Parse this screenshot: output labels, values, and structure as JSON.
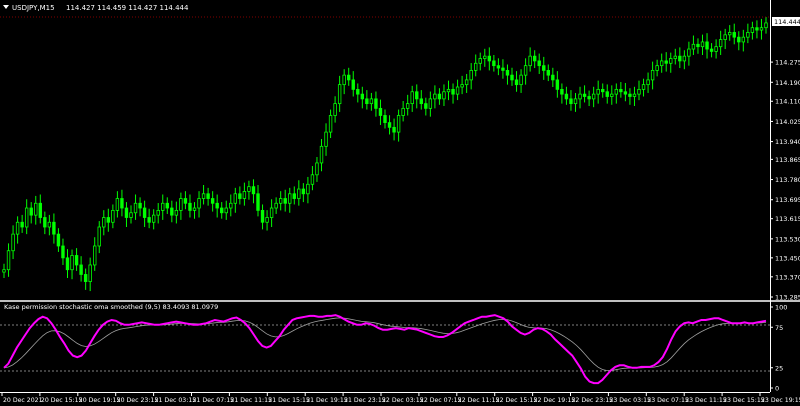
{
  "window": {
    "symbol_label": "USDJPY,M15",
    "ohlc_label": "114.427 114.459 114.427 114.444"
  },
  "main_chart": {
    "current_price_label": "114.444",
    "price_ticks": [
      "114.444",
      "114.275",
      "114.190",
      "114.110",
      "114.025",
      "113.940",
      "113.865",
      "113.780",
      "113.695",
      "113.615",
      "113.530",
      "113.450",
      "113.370",
      "113.285"
    ],
    "candles": [
      113.4,
      113.48,
      113.55,
      113.6,
      113.58,
      113.66,
      113.63,
      113.68,
      113.62,
      113.58,
      113.6,
      113.55,
      113.5,
      113.45,
      113.4,
      113.46,
      113.42,
      113.38,
      113.35,
      113.42,
      113.5,
      113.58,
      113.62,
      113.6,
      113.65,
      113.7,
      113.66,
      113.62,
      113.64,
      113.68,
      113.66,
      113.62,
      113.6,
      113.63,
      113.65,
      113.68,
      113.66,
      113.63,
      113.65,
      113.7,
      113.68,
      113.65,
      113.66,
      113.7,
      113.72,
      113.7,
      113.68,
      113.66,
      113.64,
      113.66,
      113.68,
      113.72,
      113.7,
      113.73,
      113.75,
      113.72,
      113.65,
      113.6,
      113.62,
      113.66,
      113.68,
      113.7,
      113.68,
      113.72,
      113.7,
      113.74,
      113.72,
      113.76,
      113.8,
      113.85,
      113.92,
      113.98,
      114.05,
      114.1,
      114.18,
      114.22,
      114.2,
      114.16,
      114.14,
      114.12,
      114.1,
      114.12,
      114.08,
      114.05,
      114.02,
      114.0,
      113.98,
      114.05,
      114.08,
      114.1,
      114.15,
      114.12,
      114.1,
      114.08,
      114.12,
      114.14,
      114.12,
      114.15,
      114.16,
      114.14,
      114.17,
      114.18,
      114.2,
      114.24,
      114.27,
      114.29,
      114.3,
      114.28,
      114.26,
      114.25,
      114.24,
      114.22,
      114.2,
      114.18,
      114.22,
      114.26,
      114.3,
      114.28,
      114.26,
      114.24,
      114.22,
      114.2,
      114.16,
      114.14,
      114.12,
      114.1,
      114.12,
      114.14,
      114.13,
      114.12,
      114.14,
      114.16,
      114.15,
      114.13,
      114.14,
      114.16,
      114.15,
      114.14,
      114.13,
      114.14,
      114.16,
      114.18,
      114.2,
      114.24,
      114.26,
      114.28,
      114.27,
      114.29,
      114.3,
      114.28,
      114.3,
      114.33,
      114.35,
      114.34,
      114.36,
      114.33,
      114.32,
      114.34,
      114.37,
      114.39,
      114.4,
      114.38,
      114.36,
      114.38,
      114.4,
      114.42,
      114.41,
      114.42,
      114.44
    ]
  },
  "indicator": {
    "label": "Kase permission stochastic oma smoothed (9,5) 83.4093 81.0979",
    "level_ticks": [
      "100",
      "75",
      "25",
      "0"
    ],
    "main_series": [
      25,
      30,
      40,
      50,
      58,
      66,
      74,
      80,
      85,
      88,
      86,
      80,
      72,
      63,
      55,
      46,
      40,
      38,
      40,
      46,
      55,
      64,
      72,
      78,
      82,
      84,
      83,
      80,
      78,
      78,
      79,
      80,
      81,
      80,
      79,
      78,
      78,
      79,
      80,
      81,
      82,
      81,
      80,
      79,
      78,
      78,
      79,
      80,
      82,
      84,
      83,
      82,
      84,
      86,
      87,
      84,
      80,
      74,
      66,
      58,
      52,
      50,
      52,
      58,
      64,
      72,
      78,
      84,
      86,
      87,
      88,
      89,
      89,
      88,
      88,
      89,
      89,
      90,
      88,
      85,
      82,
      80,
      78,
      78,
      80,
      79,
      77,
      74,
      72,
      72,
      73,
      74,
      73,
      72,
      74,
      73,
      72,
      70,
      68,
      66,
      64,
      63,
      63,
      65,
      68,
      72,
      76,
      80,
      82,
      84,
      86,
      88,
      88,
      89,
      90,
      88,
      86,
      82,
      76,
      72,
      68,
      66,
      68,
      72,
      74,
      73,
      70,
      66,
      60,
      55,
      50,
      45,
      40,
      32,
      24,
      14,
      8,
      6,
      6,
      10,
      16,
      22,
      26,
      28,
      28,
      26,
      25,
      25,
      26,
      26,
      26,
      28,
      32,
      38,
      48,
      60,
      70,
      76,
      80,
      81,
      80,
      82,
      84,
      84,
      85,
      86,
      86,
      84,
      82,
      80,
      80,
      80,
      81,
      80,
      80,
      81,
      82,
      83
    ]
  },
  "time_axis": {
    "labels": [
      "20 Dec 2021",
      "20 Dec 15:15",
      "20 Dec 19:15",
      "20 Dec 23:15",
      "21 Dec 03:15",
      "21 Dec 07:15",
      "21 Dec 11:15",
      "21 Dec 15:15",
      "21 Dec 19:15",
      "21 Dec 23:15",
      "22 Dec 03:15",
      "22 Dec 07:15",
      "22 Dec 11:15",
      "22 Dec 15:15",
      "22 Dec 19:15",
      "22 Dec 23:15",
      "23 Dec 03:15",
      "23 Dec 07:15",
      "23 Dec 11:15",
      "23 Dec 15:15",
      "23 Dec 19:15"
    ]
  },
  "colors": {
    "background": "#000000",
    "candle": "#00ff00",
    "indicator_main": "#ff00ff",
    "indicator_signal": "#a0a0a0",
    "axis_text": "#ffffff",
    "grid_dotted": "#808080",
    "price_marker_bg": "#ffffff",
    "price_marker_text": "#000000"
  }
}
